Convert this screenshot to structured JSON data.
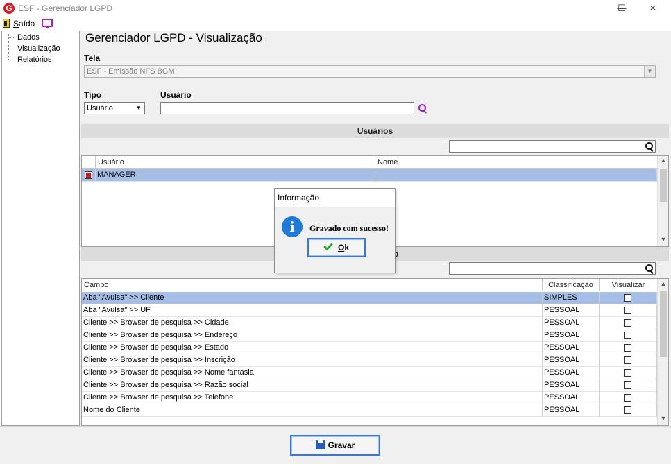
{
  "window": {
    "title": "ESF - Gerenciador LGPD",
    "logo_letter": "G",
    "minimize_glyph": "—",
    "maximize_glyph": "☐",
    "close_glyph": "✕"
  },
  "toolbar": {
    "exit_first_letter": "S",
    "exit_rest": "aída"
  },
  "sidebar": {
    "items": [
      {
        "label": "Dados"
      },
      {
        "label": "Visualização"
      },
      {
        "label": "Relatórios"
      }
    ]
  },
  "main": {
    "title": "Gerenciador LGPD - Visualização",
    "tela_label": "Tela",
    "tela_value": "ESF - Emissão NFS BGM",
    "tipo_label": "Tipo",
    "tipo_value": "Usuário",
    "usuario_label": "Usuário",
    "usuario_value": ""
  },
  "users_section": {
    "title": "Usuários",
    "columns": [
      "Usuário",
      "Nome"
    ],
    "rows": [
      {
        "usuario": "MANAGER",
        "nome": "",
        "checked": true
      }
    ]
  },
  "fields_section": {
    "title_fragment": "o",
    "columns": [
      "Campo",
      "Classificação",
      "Visualizar"
    ],
    "rows": [
      {
        "campo": "Aba \"Avulsa\" >> Cliente",
        "classificacao": "SIMPLES"
      },
      {
        "campo": "Aba \"Avulsa\" >> UF",
        "classificacao": "PESSOAL"
      },
      {
        "campo": "Cliente >> Browser de pesquisa >> Cidade",
        "classificacao": "PESSOAL"
      },
      {
        "campo": "Cliente >> Browser de pesquisa >> Endereço",
        "classificacao": "PESSOAL"
      },
      {
        "campo": "Cliente >> Browser de pesquisa >> Estado",
        "classificacao": "PESSOAL"
      },
      {
        "campo": "Cliente >> Browser de pesquisa >> Inscrição",
        "classificacao": "PESSOAL"
      },
      {
        "campo": "Cliente >> Browser de pesquisa >> Nome fantasia",
        "classificacao": "PESSOAL"
      },
      {
        "campo": "Cliente >> Browser de pesquisa >> Razão social",
        "classificacao": "PESSOAL"
      },
      {
        "campo": "Cliente >> Browser de pesquisa >> Telefone",
        "classificacao": "PESSOAL"
      },
      {
        "campo": "Nome do Cliente",
        "classificacao": "PESSOAL"
      }
    ]
  },
  "dialog": {
    "title": "Informação",
    "icon_letter": "i",
    "message": "Gravado com sucesso!",
    "ok_first_letter": "O",
    "ok_rest": "k"
  },
  "save_button": {
    "first_letter": "G",
    "rest": "ravar"
  },
  "colors": {
    "selection": "#a6bde6",
    "button_border": "#3a78d8",
    "info_icon": "#1e7ad6",
    "search_icon_purple": "#a020c0",
    "logo_red": "#d41b23"
  }
}
